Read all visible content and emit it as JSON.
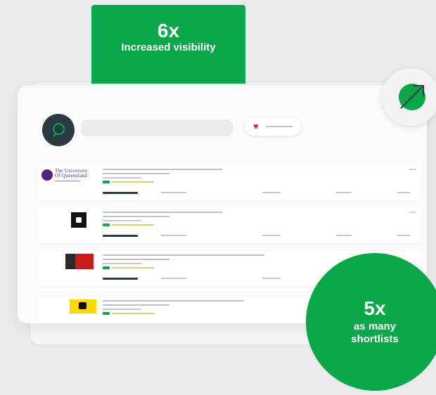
{
  "badges": {
    "visibility": {
      "value": "6x",
      "label": "Increased visibility"
    },
    "shortlists": {
      "value": "5x",
      "label_line1": "as many",
      "label_line2": "shortlists"
    }
  },
  "search": {
    "icon": "search-icon"
  },
  "favourites": {
    "icon": "heart-icon"
  },
  "trend_icon": "arrow-up-right-icon",
  "listings": [
    {
      "logo_line1": "The University",
      "logo_line2": "Of Queensland",
      "logo_line3": "AUSTRALIA"
    },
    {
      "logo": "black-square-logo"
    },
    {
      "logo": "red-black-logo"
    },
    {
      "logo": "yellow-logo"
    }
  ],
  "colors": {
    "brand_green": "#0aa64a",
    "dark": "#2a3944",
    "uq_purple": "#51247a"
  }
}
